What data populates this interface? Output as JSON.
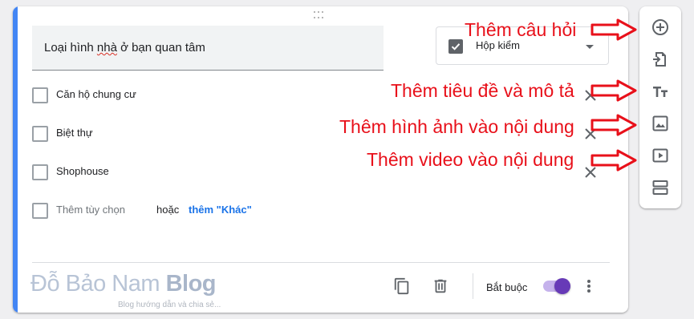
{
  "question": {
    "title_prefix": "Loại hình ",
    "title_misspelled": "nhà",
    "title_suffix": " ở bạn quan tâm"
  },
  "type_select": {
    "label": "Hộp kiểm",
    "icon": "checkbox-icon"
  },
  "options": [
    {
      "label": "Căn hộ chung cư"
    },
    {
      "label": "Biệt thự"
    },
    {
      "label": "Shophouse"
    }
  ],
  "add_option": {
    "label": "Thêm tùy chọn",
    "or": "hoặc",
    "add_other": "thêm \"Khác\""
  },
  "watermark": {
    "name_light": "Đỗ Bảo Nam ",
    "name_bold": "Blog",
    "tagline": "Blog hướng dẫn và chia sẻ..."
  },
  "footer": {
    "required_label": "Bắt buộc",
    "required_on": true
  },
  "toolbar": {
    "items": [
      {
        "icon": "add-circle-icon"
      },
      {
        "icon": "import-questions-icon"
      },
      {
        "icon": "title-text-icon"
      },
      {
        "icon": "image-icon"
      },
      {
        "icon": "video-icon"
      },
      {
        "icon": "section-icon"
      }
    ]
  },
  "annotations": [
    "Thêm câu hỏi",
    "Thêm tiêu đề và mô tả",
    "Thêm hình ảnh vào nội dung",
    "Thêm video vào nội dung"
  ],
  "colors": {
    "accent_bar": "#4285f4",
    "toggle": "#673ab7",
    "link": "#1a73e8",
    "annotation": "#e8101a"
  }
}
